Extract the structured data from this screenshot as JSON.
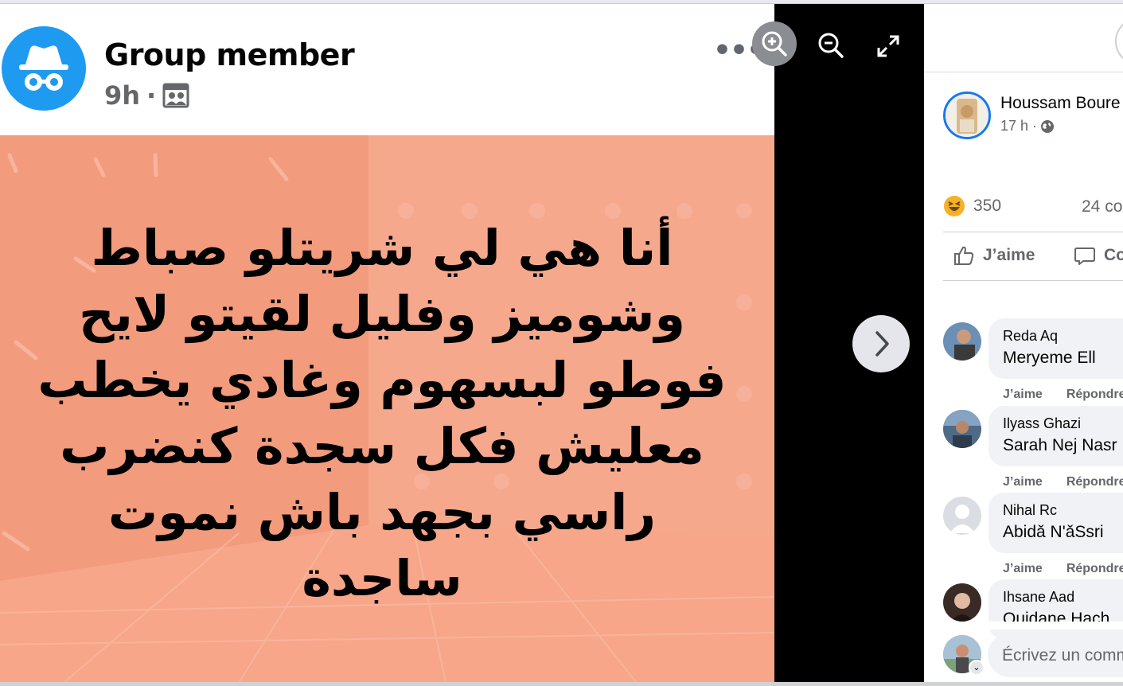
{
  "post": {
    "author": "Group member",
    "time": "9h",
    "separator": "·",
    "body_text": "أنا هي لي شريتلو صباط وشوميز وفليل لقيتو لايح فوطو لبسهوم وغادي يخطب معليش فكل سجدة كنضرب راسي بجهد باش نموت ساجدة",
    "audience_icon": "group-icon",
    "more_icon": "more-dots-icon",
    "image_bg_color": "#f4a083"
  },
  "viewer": {
    "zoom_in_icon": "zoom-in-icon",
    "zoom_out_icon": "zoom-out-icon",
    "expand_icon": "expand-icon",
    "next_icon": "chevron-right-icon"
  },
  "side": {
    "poster_name": "Houssam Boure",
    "poster_time": "17 h ·",
    "reaction_count": "350",
    "comment_count": "24 co",
    "like_label": "J’aime",
    "comment_label": "Co",
    "comments": [
      {
        "author": "Reda Aq",
        "text": "Meryeme Ell",
        "like": "J’aime",
        "reply": "Répondre"
      },
      {
        "author": "Ilyass Ghazi",
        "text": "Sarah Nej Nasr",
        "like": "J’aime",
        "reply": "Répondre"
      },
      {
        "author": "Nihal Rc",
        "text": "Abidǎ N'ǎSsri",
        "like": "J’aime",
        "reply": "Répondre"
      },
      {
        "author": "Ihsane Aad",
        "text": "Ouidane Hach"
      }
    ],
    "write_placeholder": "Écrivez un comm"
  },
  "colors": {
    "accent": "#1877f2",
    "anon_avatar": "#1e9bf0",
    "reaction_yellow": "#f7b125"
  }
}
